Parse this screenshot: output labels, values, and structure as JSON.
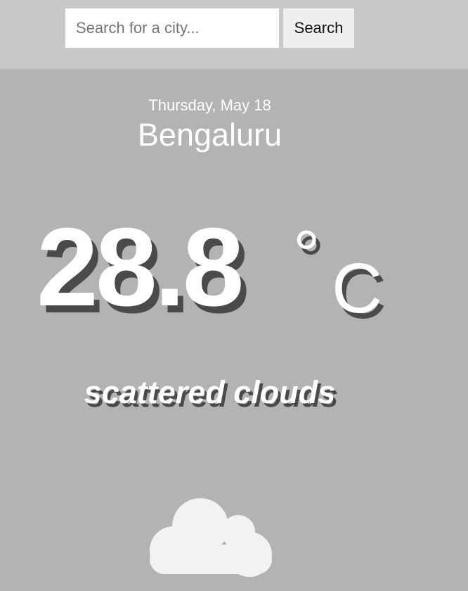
{
  "search": {
    "placeholder": "Search for a city...",
    "value": "",
    "button_label": "Search"
  },
  "weather": {
    "date": "Thursday, May 18",
    "city": "Bengaluru",
    "temperature": "28.8",
    "degree_symbol": "°",
    "unit": "C",
    "condition": "scattered clouds",
    "icon": "cloud-icon"
  },
  "colors": {
    "background": "#b3b3b3",
    "top_bar": "#c8c8c8",
    "text": "#ffffff",
    "shadow": "#4a4a4a",
    "cloud": "#f2f2f2"
  }
}
